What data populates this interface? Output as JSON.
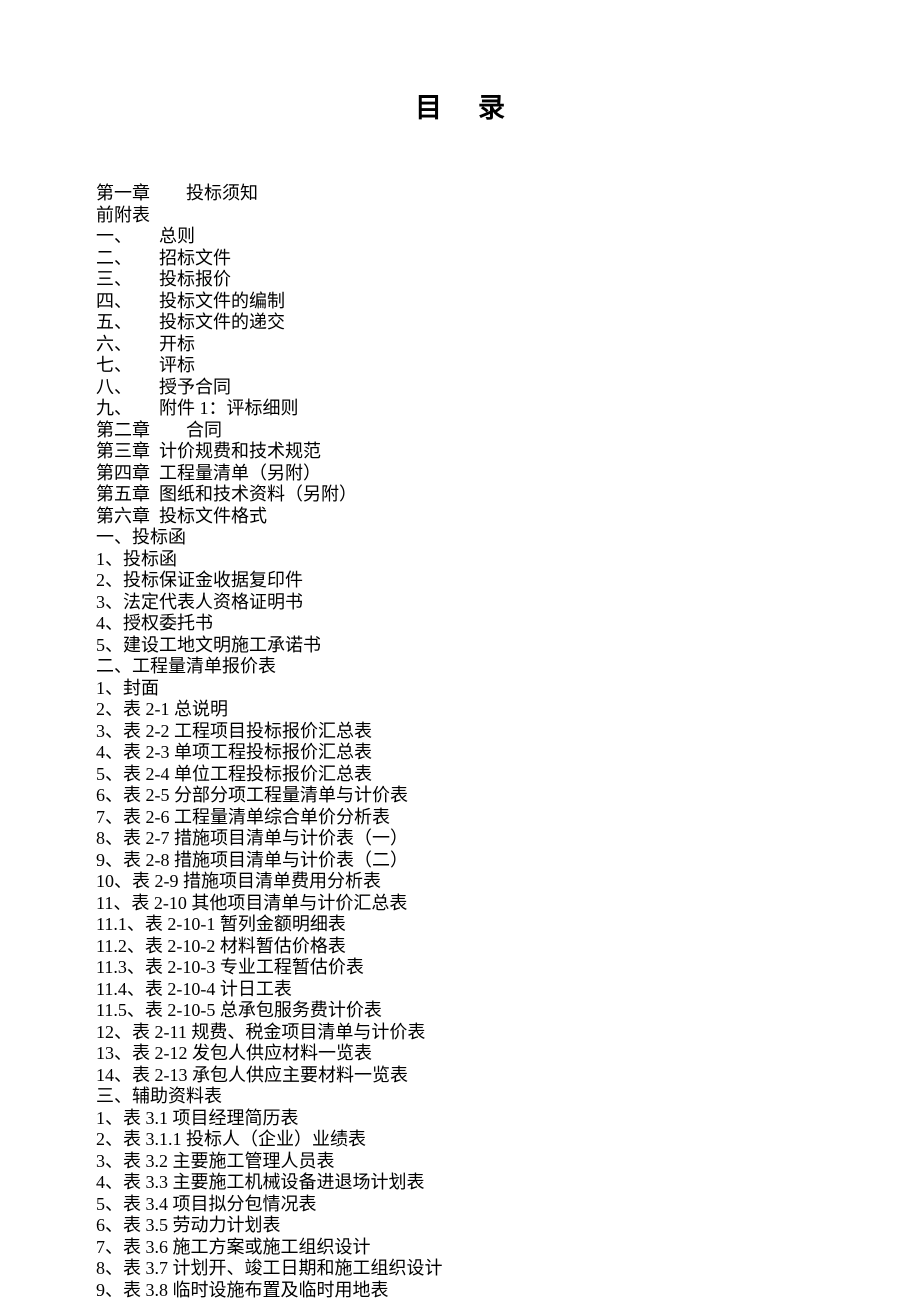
{
  "title": "目录",
  "entries": [
    {
      "prefix": "第一章　　",
      "text": "投标须知"
    },
    {
      "prefix": "",
      "text": "前附表"
    },
    {
      "prefix": "一、　　",
      "text": "总则"
    },
    {
      "prefix": "二、　　",
      "text": "招标文件"
    },
    {
      "prefix": "三、　　",
      "text": "投标报价"
    },
    {
      "prefix": "四、　　",
      "text": "投标文件的编制"
    },
    {
      "prefix": "五、　　",
      "text": "投标文件的递交"
    },
    {
      "prefix": "六、　　",
      "text": "开标"
    },
    {
      "prefix": "七、　　",
      "text": "评标"
    },
    {
      "prefix": "八、　　",
      "text": "授予合同"
    },
    {
      "prefix": "九、　　",
      "text": "附件 1：评标细则"
    },
    {
      "prefix": "第二章　　",
      "text": "合同"
    },
    {
      "prefix": "第三章  ",
      "text": "计价规费和技术规范"
    },
    {
      "prefix": "第四章  ",
      "text": "工程量清单（另附）"
    },
    {
      "prefix": "第五章  ",
      "text": "图纸和技术资料（另附）"
    },
    {
      "prefix": "第六章  ",
      "text": "投标文件格式"
    },
    {
      "prefix": "",
      "text": "一、投标函"
    },
    {
      "prefix": "",
      "text": "1、投标函"
    },
    {
      "prefix": "",
      "text": "2、投标保证金收据复印件"
    },
    {
      "prefix": "",
      "text": "3、法定代表人资格证明书"
    },
    {
      "prefix": "",
      "text": "4、授权委托书"
    },
    {
      "prefix": "",
      "text": "5、建设工地文明施工承诺书"
    },
    {
      "prefix": "",
      "text": "二、工程量清单报价表"
    },
    {
      "prefix": "",
      "text": "1、封面"
    },
    {
      "prefix": "",
      "text": "2、表 2-1 总说明"
    },
    {
      "prefix": "",
      "text": "3、表 2-2 工程项目投标报价汇总表"
    },
    {
      "prefix": "",
      "text": "4、表 2-3 单项工程投标报价汇总表"
    },
    {
      "prefix": "",
      "text": "5、表 2-4 单位工程投标报价汇总表"
    },
    {
      "prefix": "",
      "text": "6、表 2-5 分部分项工程量清单与计价表"
    },
    {
      "prefix": "",
      "text": "7、表 2-6 工程量清单综合单价分析表"
    },
    {
      "prefix": "",
      "text": "8、表 2-7 措施项目清单与计价表（一）"
    },
    {
      "prefix": "",
      "text": "9、表 2-8 措施项目清单与计价表（二）"
    },
    {
      "prefix": "",
      "text": "10、表 2-9 措施项目清单费用分析表"
    },
    {
      "prefix": "",
      "text": "11、表 2-10 其他项目清单与计价汇总表"
    },
    {
      "prefix": "",
      "text": "11.1、表 2-10-1 暂列金额明细表"
    },
    {
      "prefix": "",
      "text": "11.2、表 2-10-2 材料暂估价格表"
    },
    {
      "prefix": "",
      "text": "11.3、表 2-10-3 专业工程暂估价表"
    },
    {
      "prefix": "",
      "text": "11.4、表 2-10-4 计日工表"
    },
    {
      "prefix": "",
      "text": "11.5、表 2-10-5 总承包服务费计价表"
    },
    {
      "prefix": "",
      "text": "12、表 2-11 规费、税金项目清单与计价表"
    },
    {
      "prefix": "",
      "text": "13、表 2-12 发包人供应材料一览表"
    },
    {
      "prefix": "",
      "text": "14、表 2-13 承包人供应主要材料一览表"
    },
    {
      "prefix": "",
      "text": "三、辅助资料表"
    },
    {
      "prefix": "",
      "text": "1、表 3.1 项目经理简历表"
    },
    {
      "prefix": "",
      "text": "2、表 3.1.1 投标人（企业）业绩表"
    },
    {
      "prefix": "",
      "text": "3、表 3.2 主要施工管理人员表"
    },
    {
      "prefix": "",
      "text": "4、表 3.3 主要施工机械设备进退场计划表"
    },
    {
      "prefix": "",
      "text": "5、表 3.4 项目拟分包情况表"
    },
    {
      "prefix": "",
      "text": "6、表 3.5 劳动力计划表"
    },
    {
      "prefix": "",
      "text": "7、表 3.6 施工方案或施工组织设计"
    },
    {
      "prefix": "",
      "text": "8、表 3.7 计划开、竣工日期和施工组织设计"
    },
    {
      "prefix": "",
      "text": "9、表 3.8 临时设施布置及临时用地表"
    }
  ]
}
